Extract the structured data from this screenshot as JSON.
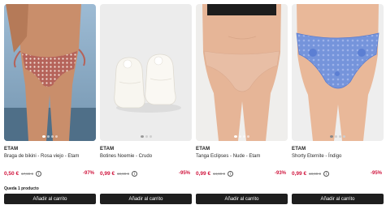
{
  "products": [
    {
      "brand": "ETAM",
      "name": "Braga de bikini - Rosa viejo - Etam",
      "price": "0,50 €",
      "old_price": "17,99 €",
      "discount": "-97%",
      "stock": "Queda 1 producto",
      "cart_label": "Añadir al carrito",
      "image_icon": "product-photo-bikini-bottom",
      "colors": {
        "bg_top": "#8fb2cf",
        "bg_bottom": "#6d8ea8",
        "skin": "#c98e6b",
        "garment": "#b8655a"
      }
    },
    {
      "brand": "ETAM",
      "name": "Botines Noemie - Crudo",
      "price": "0,99 €",
      "old_price": "19,99 €",
      "discount": "-95%",
      "stock": "",
      "cart_label": "Añadir al carrito",
      "image_icon": "product-photo-slipper-boots",
      "colors": {
        "bg_top": "#efefef",
        "bg_bottom": "#e4e4e4",
        "garment": "#f7f5ef"
      }
    },
    {
      "brand": "ETAM",
      "name": "Tanga Eclipses - Nude - Etam",
      "price": "0,99 €",
      "old_price": "14,99 €",
      "discount": "-93%",
      "stock": "",
      "cart_label": "Añadir al carrito",
      "image_icon": "product-photo-thong",
      "colors": {
        "bg_top": "#f2f2f0",
        "bg_bottom": "#e8e6e2",
        "skin": "#e7b79a",
        "garment": "#e9c0a7"
      }
    },
    {
      "brand": "ETAM",
      "name": "Shorty Eternite - Índigo",
      "price": "0,99 €",
      "old_price": "18,99 €",
      "discount": "-95%",
      "stock": "",
      "cart_label": "Añadir al carrito",
      "image_icon": "product-photo-lace-shorty",
      "colors": {
        "bg_top": "#f0f0f0",
        "bg_bottom": "#e6e6e6",
        "skin": "#e9b899",
        "garment": "#6f8fd9"
      }
    }
  ]
}
